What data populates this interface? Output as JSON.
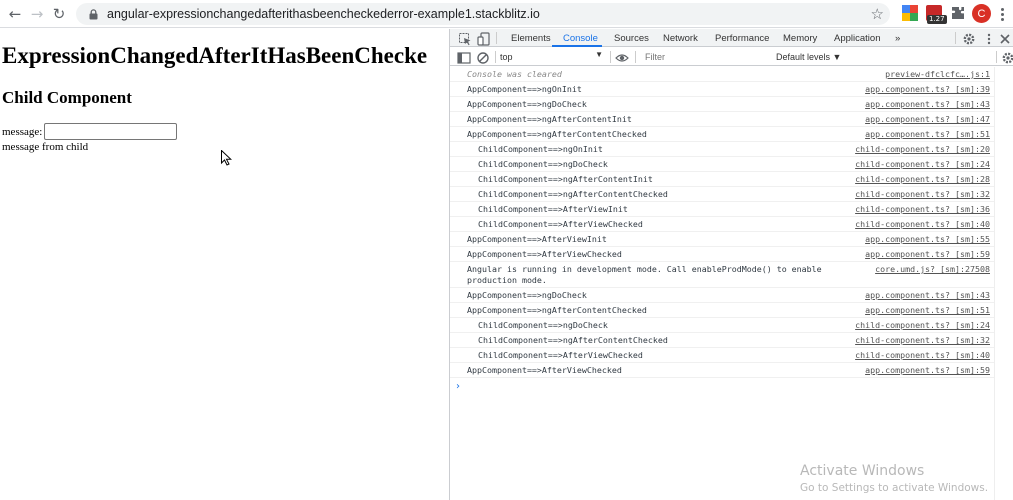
{
  "browser": {
    "url": "angular-expressionchangedafterithasbeencheckederror-example1.stackblitz.io",
    "icons": [
      "back-icon",
      "forward-icon",
      "reload-icon",
      "lock-icon",
      "star-icon",
      "extensions-icon"
    ],
    "ext_badge": "1.27",
    "profile_initial": "C"
  },
  "page": {
    "title": "ExpressionChangedAfterItHasBeenChecke",
    "subtitle": "Child Component",
    "message_label": "message:",
    "message_value": "",
    "child_message": "message from child"
  },
  "devtools": {
    "tabs": [
      "Elements",
      "Console",
      "Sources",
      "Network",
      "Performance",
      "Memory",
      "Application",
      "»"
    ],
    "active_tab": "Console",
    "context": "top",
    "filter_placeholder": "Filter",
    "levels": "Default levels ▼",
    "messages": [
      {
        "text": "Console was cleared",
        "source": "preview-dfclcfc….js:1",
        "indent": false,
        "cleared": true
      },
      {
        "text": "AppComponent==>ngOnInit",
        "source": "app.component.ts? [sm]:39",
        "indent": false
      },
      {
        "text": "AppComponent==>ngDoCheck",
        "source": "app.component.ts? [sm]:43",
        "indent": false
      },
      {
        "text": "AppComponent==>ngAfterContentInit",
        "source": "app.component.ts? [sm]:47",
        "indent": false
      },
      {
        "text": "AppComponent==>ngAfterContentChecked",
        "source": "app.component.ts? [sm]:51",
        "indent": false
      },
      {
        "text": "ChildComponent==>ngOnInit",
        "source": "child-component.ts? [sm]:20",
        "indent": true
      },
      {
        "text": "ChildComponent==>ngDoCheck",
        "source": "child-component.ts? [sm]:24",
        "indent": true
      },
      {
        "text": "ChildComponent==>ngAfterContentInit",
        "source": "child-component.ts? [sm]:28",
        "indent": true
      },
      {
        "text": "ChildComponent==>ngAfterContentChecked",
        "source": "child-component.ts? [sm]:32",
        "indent": true
      },
      {
        "text": "ChildComponent==>AfterViewInit",
        "source": "child-component.ts? [sm]:36",
        "indent": true
      },
      {
        "text": "ChildComponent==>AfterViewChecked",
        "source": "child-component.ts? [sm]:40",
        "indent": true
      },
      {
        "text": "AppComponent==>AfterViewInit",
        "source": "app.component.ts? [sm]:55",
        "indent": false
      },
      {
        "text": "AppComponent==>AfterViewChecked",
        "source": "app.component.ts? [sm]:59",
        "indent": false
      },
      {
        "text": "Angular is running in development mode. Call enableProdMode() to enable\nproduction mode.",
        "source": "core.umd.js? [sm]:27508",
        "indent": false,
        "tall": true
      },
      {
        "text": "AppComponent==>ngDoCheck",
        "source": "app.component.ts? [sm]:43",
        "indent": false
      },
      {
        "text": "AppComponent==>ngAfterContentChecked",
        "source": "app.component.ts? [sm]:51",
        "indent": false
      },
      {
        "text": "ChildComponent==>ngDoCheck",
        "source": "child-component.ts? [sm]:24",
        "indent": true
      },
      {
        "text": "ChildComponent==>ngAfterContentChecked",
        "source": "child-component.ts? [sm]:32",
        "indent": true
      },
      {
        "text": "ChildComponent==>AfterViewChecked",
        "source": "child-component.ts? [sm]:40",
        "indent": true
      },
      {
        "text": "AppComponent==>AfterViewChecked",
        "source": "app.component.ts? [sm]:59",
        "indent": false
      }
    ],
    "prompt": "›"
  },
  "watermark": {
    "line1": "Activate Windows",
    "line2": "Go to Settings to activate Windows."
  },
  "colors": {
    "accent": "#1a73e8",
    "profile": "#d93025"
  }
}
